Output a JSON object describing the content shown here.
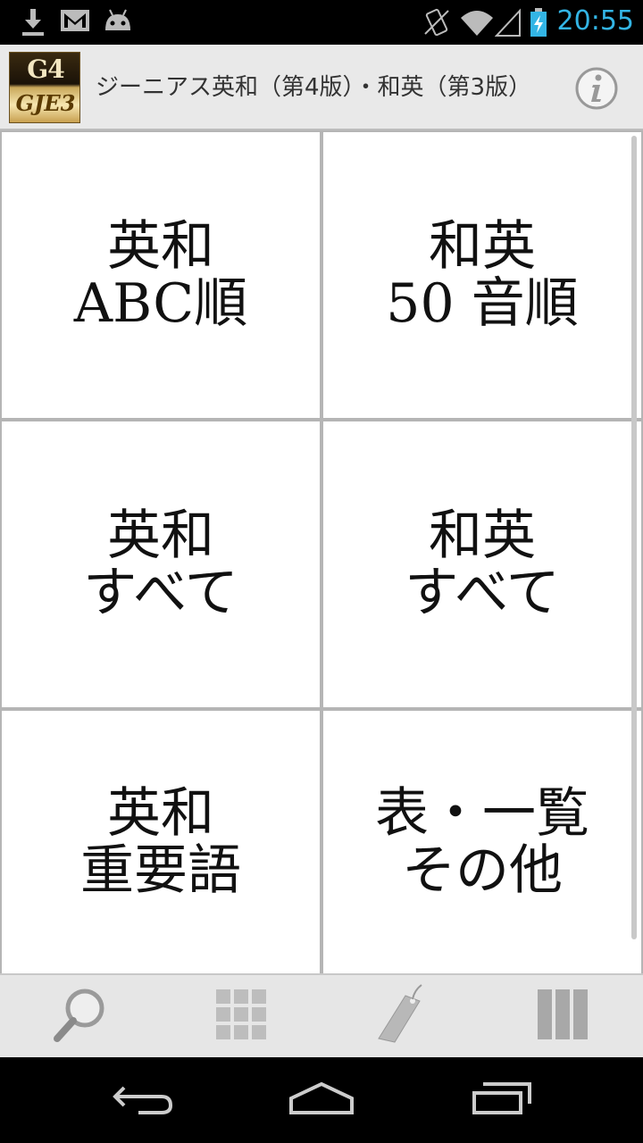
{
  "status_bar": {
    "time": "20:55",
    "icons": [
      "download-icon",
      "gmail-icon",
      "android-debug-icon",
      "vibrate-icon",
      "wifi-icon",
      "signal-icon",
      "battery-charging-icon"
    ],
    "time_color": "#33b5e5"
  },
  "header": {
    "logo_top": "G4",
    "logo_bottom": "GJE3",
    "title": "ジーニアス英和（第4版）・和英（第3版）",
    "info_icon": "info-icon"
  },
  "menu": [
    {
      "line1": "英和",
      "line2": "ABC順"
    },
    {
      "line1": "和英",
      "line2": "50 音順"
    },
    {
      "line1": "英和",
      "line2": "すべて"
    },
    {
      "line1": "和英",
      "line2": "すべて"
    },
    {
      "line1": "英和",
      "line2": "重要語"
    },
    {
      "line1": "表・一覧",
      "line2": "その他"
    }
  ],
  "toolbar": {
    "icons": [
      "search-icon",
      "grid-icon",
      "bookmark-tag-icon",
      "columns-icon"
    ]
  },
  "nav_bar": {
    "icons": [
      "back-icon",
      "home-icon",
      "recents-icon"
    ]
  }
}
